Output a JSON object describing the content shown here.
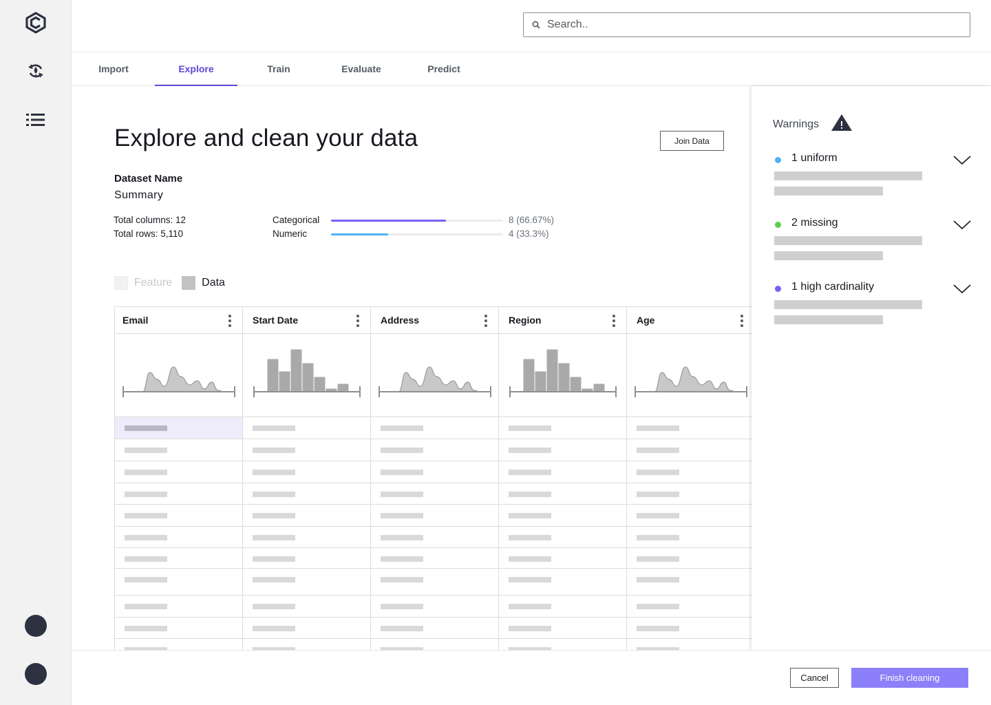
{
  "sidebar": {
    "icons": [
      "logo-icon",
      "refresh-icon",
      "list-icon"
    ],
    "avatars": 2
  },
  "header": {
    "search_placeholder": "Search.."
  },
  "tabs": [
    {
      "label": "Import",
      "active": false
    },
    {
      "label": "Explore",
      "active": true
    },
    {
      "label": "Train",
      "active": false
    },
    {
      "label": "Evaluate",
      "active": false
    },
    {
      "label": "Predict",
      "active": false
    }
  ],
  "main": {
    "title": "Explore and clean your data",
    "join_button": "Join Data",
    "dataset_name_label": "Dataset Name",
    "summary_label": "Summary",
    "total_columns": "Total columns: 12",
    "total_rows": "Total rows: 5,110",
    "types": [
      {
        "label": "Categorical",
        "value": "8 (66.67%)",
        "fraction": 0.6667,
        "color": "#7b5cf5"
      },
      {
        "label": "Numeric",
        "value": "4 (33.3%)",
        "fraction": 0.333,
        "color": "#4fb2ee"
      }
    ],
    "legend": [
      {
        "label": "Feature",
        "color": "#f2f2f2",
        "text_color": "#c8c8c8"
      },
      {
        "label": "Data",
        "color": "#c2c2c2",
        "text_color": "#16191f"
      }
    ]
  },
  "table": {
    "columns": [
      {
        "header": "Email",
        "chart": "density"
      },
      {
        "header": "Start Date",
        "chart": "histogram"
      },
      {
        "header": "Address",
        "chart": "density"
      },
      {
        "header": "Region",
        "chart": "histogram"
      },
      {
        "header": "Age",
        "chart": "density"
      }
    ],
    "row_count": 11,
    "selected_row": 0,
    "selected_col": 0
  },
  "warnings": {
    "title": "Warnings",
    "items": [
      {
        "label": "1 uniform",
        "color": "#4fb2ee"
      },
      {
        "label": "2 missing",
        "color": "#5ad24a"
      },
      {
        "label": "1 high cardinality",
        "color": "#7b5cf5"
      }
    ]
  },
  "footer": {
    "cancel_label": "Cancel",
    "finish_label": "Finish cleaning"
  }
}
